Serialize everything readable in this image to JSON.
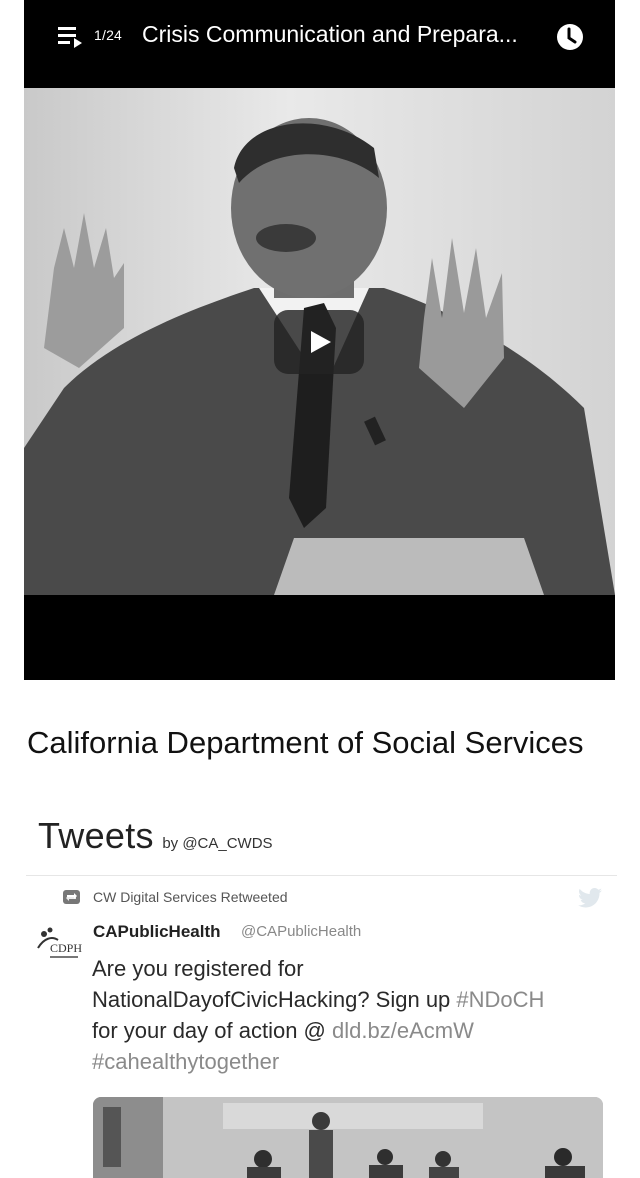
{
  "player": {
    "playlist_position": "1/24",
    "video_title": "Crisis Communication and Prepara...",
    "icons": {
      "playlist": "playlist-icon",
      "watch_later": "clock-icon",
      "play": "play-icon"
    }
  },
  "page": {
    "title": "California Department of Social Services"
  },
  "tweets": {
    "header": "Tweets",
    "by": "by @CA_CWDS",
    "items": [
      {
        "retweet_context": "CW Digital Services Retweeted",
        "author_name": "CAPublicHealth",
        "author_handle": "@CAPublicHealth",
        "avatar_text": "CDPH",
        "text_parts": [
          "Are you registered for",
          "NationalDayofCivicHacking? Sign up ",
          "#NDoCH",
          "for your day of action @ ",
          "dld.bz/eAcmW",
          "#cahealthytogether"
        ]
      }
    ]
  },
  "colors": {
    "player_background": "#000000",
    "link_gray": "#8a8a8a",
    "page_background": "#ffffff"
  }
}
